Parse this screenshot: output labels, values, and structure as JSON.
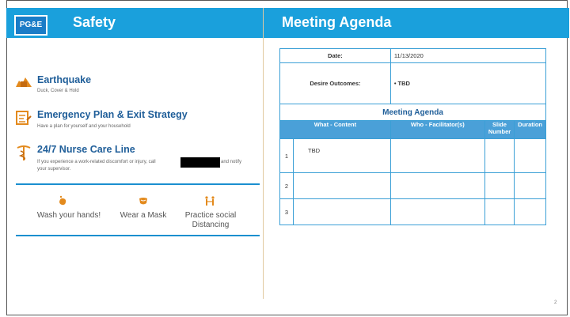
{
  "header": {
    "logo_text": "PG&E",
    "left_title": "Safety",
    "right_title": "Meeting Agenda"
  },
  "safety_items": [
    {
      "icon": "earthquake-icon",
      "title": "Earthquake",
      "subtitle": "Duck, Cover & Hold"
    },
    {
      "icon": "exit-plan-icon",
      "title": "Emergency Plan & Exit Strategy",
      "subtitle": "Have a plan for yourself and your household"
    },
    {
      "icon": "caduceus-icon",
      "title": "24/7 Nurse Care Line",
      "subtitle_a": "If you experience a work-related discomfort or injury, call",
      "subtitle_b": "and notify",
      "subtitle_c": "your supervisor."
    }
  ],
  "hygiene": [
    {
      "icon": "hand-wash-icon",
      "label_1": "Wash your hands!",
      "label_2": ""
    },
    {
      "icon": "mask-icon",
      "label_1": "Wear a Mask",
      "label_2": ""
    },
    {
      "icon": "distancing-icon",
      "label_1": "Practice social",
      "label_2": "Distancing"
    }
  ],
  "agenda": {
    "date_label": "Date:",
    "date_value": "11/13/2020",
    "outcomes_label": "Desire Outcomes:",
    "outcomes_value": "•   TBD",
    "section_title": "Meeting Agenda",
    "columns": [
      "What - Content",
      "Who - Facilitator(s)",
      "Slide Number",
      "Duration"
    ],
    "rows": [
      {
        "num": "1",
        "content": "TBD",
        "who": "",
        "slide": "",
        "duration": ""
      },
      {
        "num": "2",
        "content": "",
        "who": "",
        "slide": "",
        "duration": ""
      },
      {
        "num": "3",
        "content": "",
        "who": "",
        "slide": "",
        "duration": ""
      }
    ]
  },
  "page_number": "2",
  "colors": {
    "header_blue": "#1aa0dc",
    "title_blue": "#1f5e99",
    "accent_orange": "#e38a1d"
  }
}
